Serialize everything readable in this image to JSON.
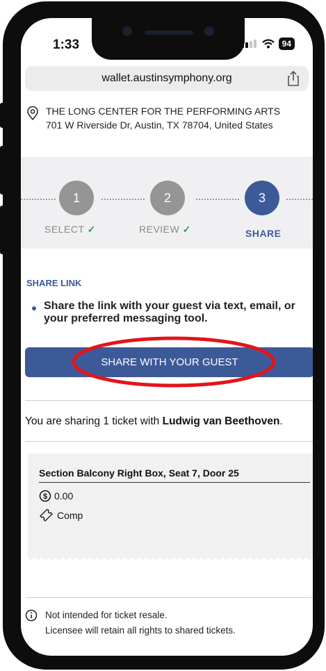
{
  "status_bar": {
    "time": "1:33",
    "battery": "94"
  },
  "browser": {
    "url": "wallet.austinsymphony.org"
  },
  "venue": {
    "name": "THE LONG CENTER FOR THE PERFORMING ARTS",
    "address": "701 W Riverside Dr, Austin, TX 78704, United States"
  },
  "stepper": {
    "steps": [
      {
        "number": "1",
        "label": "SELECT",
        "state": "done"
      },
      {
        "number": "2",
        "label": "REVIEW",
        "state": "done"
      },
      {
        "number": "3",
        "label": "SHARE",
        "state": "active"
      }
    ],
    "check": "✓"
  },
  "share_section": {
    "heading": "SHARE LINK",
    "instruction": "Share the link with your guest via text, email, or your preferred messaging tool.",
    "button_label": "SHARE WITH YOUR GUEST"
  },
  "sharing_summary": {
    "prefix": "You are sharing 1 ticket with ",
    "guest": "Ludwig van Beethoven",
    "suffix": "."
  },
  "ticket": {
    "title": "Section Balcony Right Box, Seat 7, Door 25",
    "price": "0.00",
    "type": "Comp"
  },
  "notes": {
    "line1": "Not intended for ticket resale.",
    "line2": "Licensee will retain all rights to shared tickets."
  },
  "colors": {
    "accent": "#3d5a98",
    "check": "#2e9d57",
    "highlight": "#e3141c"
  },
  "icons": [
    "location-pin-icon",
    "share-icon",
    "dollar-icon",
    "ticket-icon",
    "info-icon",
    "signal-icon",
    "wifi-icon",
    "battery-icon"
  ]
}
